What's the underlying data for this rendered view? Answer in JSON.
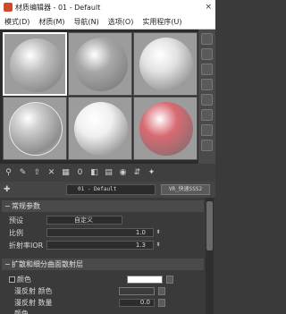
{
  "window": {
    "title": "材质编辑器 - 01 - Default",
    "close_icon": "×"
  },
  "menu": [
    "模式(D)",
    "材质(M)",
    "导航(N)",
    "选项(O)",
    "实用程序(U)"
  ],
  "slots": [
    {
      "name": "sphere-1",
      "color": "#bdbdbd"
    },
    {
      "name": "sphere-2",
      "color": "#a8a8a8"
    },
    {
      "name": "sphere-3",
      "color": "#e2e2e2"
    },
    {
      "name": "sphere-4-glass",
      "color": "#cfcfcf"
    },
    {
      "name": "sphere-5",
      "color": "#f0f0f0"
    },
    {
      "name": "sphere-6-red",
      "color": "#d96a72"
    }
  ],
  "toolbar_glyphs": [
    "⚲",
    "✎",
    "⇧",
    "✕",
    "▦",
    "0",
    "◧",
    "▤",
    "◉",
    "⇵",
    "✦"
  ],
  "material": {
    "pick_icon": "✚",
    "name": "01 - Default",
    "type": "VR_快速SSS2"
  },
  "rollout_general": {
    "title": "常规参数",
    "preset_label": "预设",
    "preset_value": "自定义",
    "scale_label": "比例",
    "scale_value": "1.0",
    "ior_label": "折射率IOR",
    "ior_value": "1.3"
  },
  "rollout_diffuse": {
    "title": "扩散和细分曲面散射层",
    "color_label": "颜色",
    "sub_color_label": "漫反射 颜色",
    "sub_amount_label": "漫反射 数量",
    "sub_amount_value": "0.0",
    "last_label": "颜色"
  },
  "colors": {
    "accent": "#ffffff",
    "diffuse_swatch": "#ffffff"
  }
}
